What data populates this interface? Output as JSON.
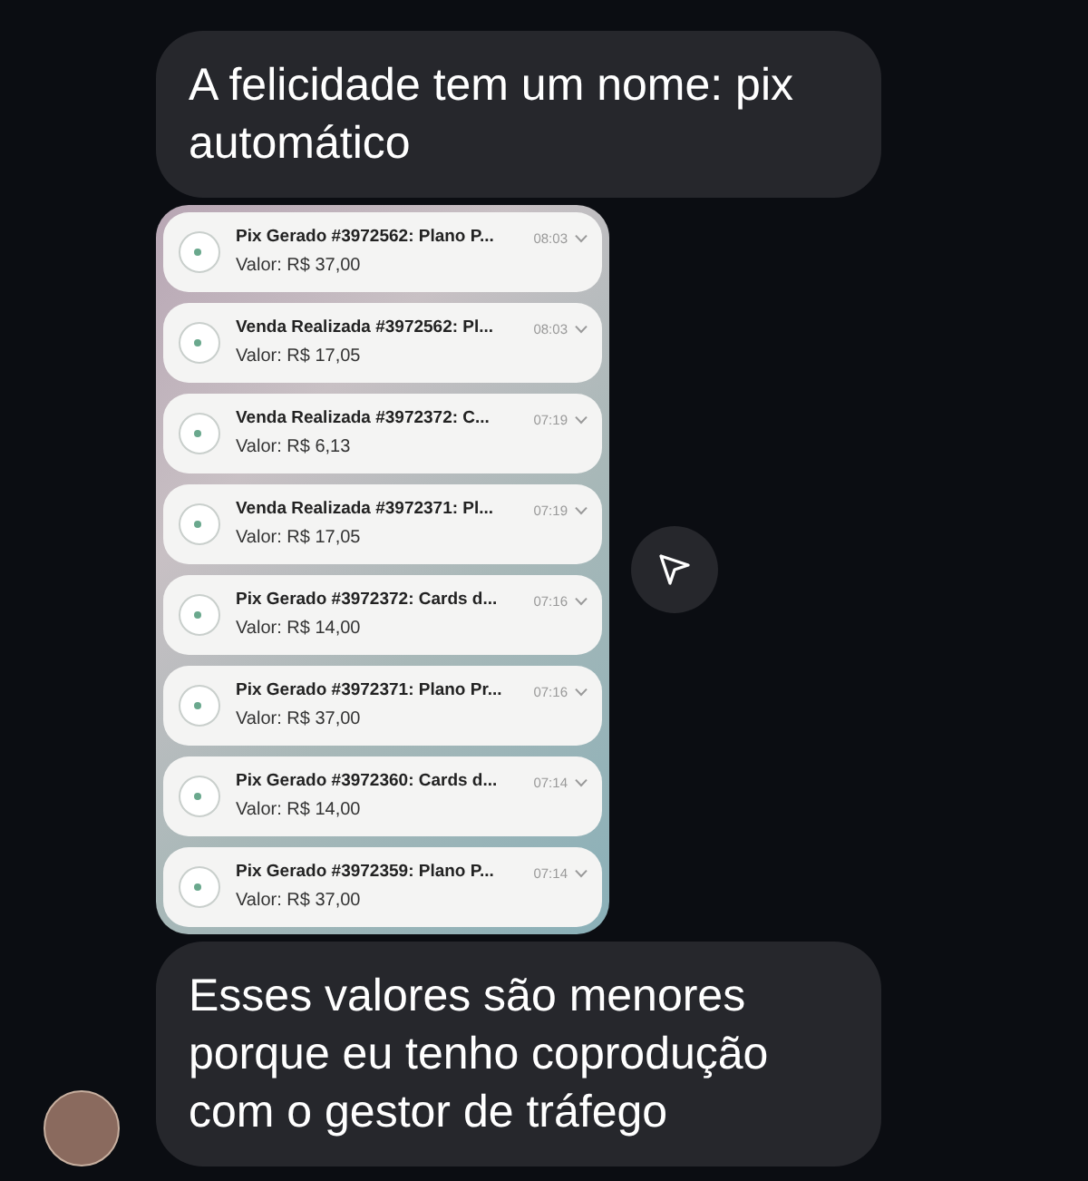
{
  "messages": [
    {
      "kind": "text",
      "text": "A felicidade tem um nome: pix automático"
    },
    {
      "kind": "screenshot",
      "notifications": [
        {
          "title": "Pix Gerado #3972562: Plano P...",
          "time": "08:03",
          "value": "Valor: R$ 37,00"
        },
        {
          "title": "Venda Realizada #3972562: Pl...",
          "time": "08:03",
          "value": "Valor: R$ 17,05"
        },
        {
          "title": "Venda Realizada #3972372: C...",
          "time": "07:19",
          "value": "Valor: R$ 6,13"
        },
        {
          "title": "Venda Realizada #3972371: Pl...",
          "time": "07:19",
          "value": "Valor: R$ 17,05"
        },
        {
          "title": "Pix Gerado #3972372: Cards d...",
          "time": "07:16",
          "value": "Valor: R$ 14,00"
        },
        {
          "title": "Pix Gerado #3972371: Plano Pr...",
          "time": "07:16",
          "value": "Valor: R$ 37,00"
        },
        {
          "title": "Pix Gerado #3972360: Cards d...",
          "time": "07:14",
          "value": "Valor: R$ 14,00"
        },
        {
          "title": "Pix Gerado #3972359: Plano P...",
          "time": "07:14",
          "value": "Valor: R$ 37,00"
        }
      ]
    },
    {
      "kind": "text",
      "text": "Esses valores são menores porque eu tenho coprodução com o gestor de tráfego",
      "avatar": true
    }
  ]
}
